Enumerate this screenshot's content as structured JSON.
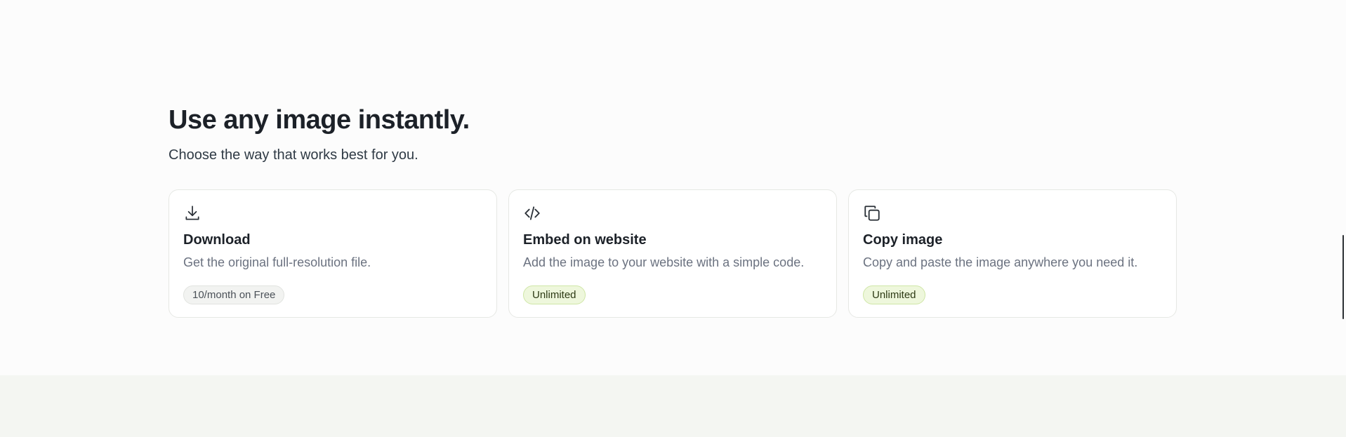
{
  "section": {
    "heading": "Use any image instantly.",
    "subheading": "Choose the way that works best for you."
  },
  "cards": [
    {
      "icon": "download-icon",
      "title": "Download",
      "description": "Get the original full-resolution file.",
      "badge": "10/month on Free",
      "badge_style": "neutral"
    },
    {
      "icon": "code-icon",
      "title": "Embed on website",
      "description": "Add the image to your website with a simple code.",
      "badge": "Unlimited",
      "badge_style": "green"
    },
    {
      "icon": "copy-icon",
      "title": "Copy image",
      "description": "Copy and paste the image anywhere you need it.",
      "badge": "Unlimited",
      "badge_style": "green"
    }
  ],
  "colors": {
    "page_background": "#fcfcfc",
    "footer_band": "#f4f6f2",
    "card_border": "#e6e8e4",
    "badge_green_bg": "#eef7dc",
    "badge_neutral_bg": "#f2f3f1"
  }
}
